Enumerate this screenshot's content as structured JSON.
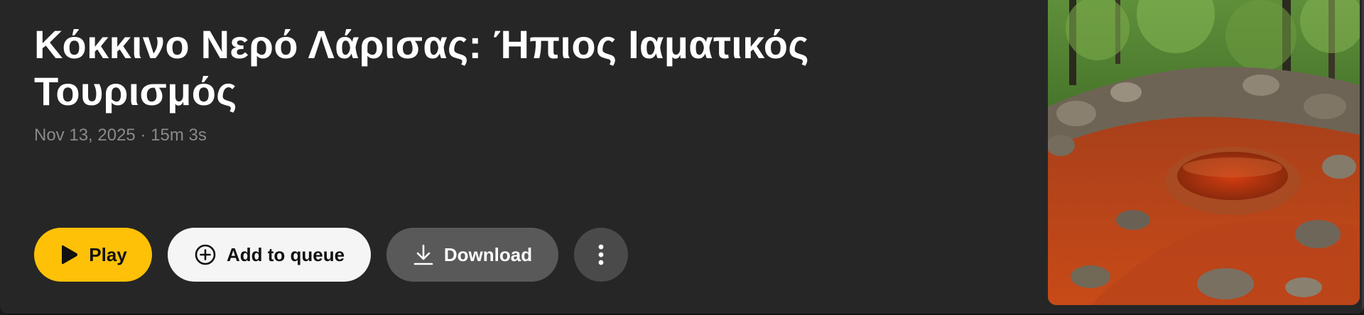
{
  "episode": {
    "title": "Κόκκινο Νερό Λάρισας: Ήπιος Ιαματικός Τουρισμός",
    "date": "Nov 13, 2025",
    "separator": "·",
    "duration": "15m 3s"
  },
  "actions": {
    "play_label": "Play",
    "queue_label": "Add to queue",
    "download_label": "Download"
  },
  "colors": {
    "card_bg": "#262626",
    "play_accent": "#ffc107",
    "queue_bg": "#f5f5f5",
    "download_bg": "#595959",
    "more_bg": "#4a4a4a",
    "meta_text": "#8a8a8a"
  },
  "icons": {
    "play": "play-icon",
    "queue": "plus-circle-icon",
    "download": "download-icon",
    "more": "more-vertical-icon"
  }
}
